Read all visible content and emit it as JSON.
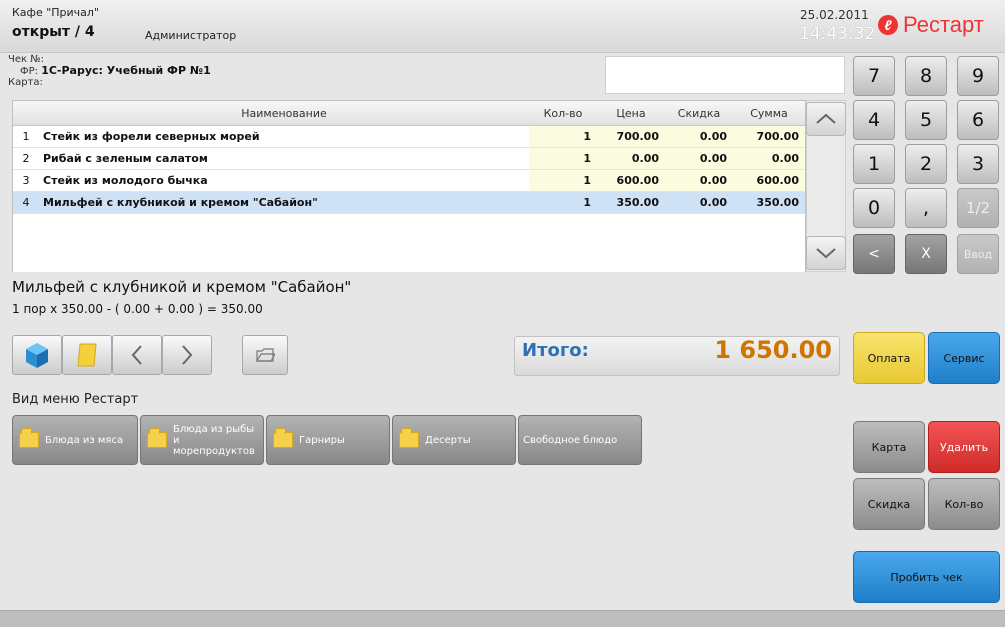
{
  "header": {
    "cafe_name": "Кафе \"Причал\"",
    "status": "открыт / 4",
    "role": "Администратор",
    "date": "25.02.2011",
    "time": "14:43:32",
    "logo": "Рестарт"
  },
  "receipt": {
    "check_label": "Чек №:",
    "fr_label": "ФР:",
    "fr_value": "1С-Рарус: Учебный ФР №1",
    "card_label": "Карта:"
  },
  "table": {
    "columns": [
      "Наименование",
      "Кол-во",
      "Цена",
      "Скидка",
      "Сумма"
    ],
    "rows": [
      {
        "num": "1",
        "name": "Стейк из форели северных морей",
        "qty": "1",
        "price": "700.00",
        "discount": "0.00",
        "sum": "700.00"
      },
      {
        "num": "2",
        "name": "Рибай с зеленым салатом",
        "qty": "1",
        "price": "0.00",
        "discount": "0.00",
        "sum": "0.00"
      },
      {
        "num": "3",
        "name": "Стейк из молодого бычка",
        "qty": "1",
        "price": "600.00",
        "discount": "0.00",
        "sum": "600.00"
      },
      {
        "num": "4",
        "name": "Мильфей с клубникой и кремом \"Сабайон\"",
        "qty": "1",
        "price": "350.00",
        "discount": "0.00",
        "sum": "350.00"
      }
    ]
  },
  "detail": {
    "title": "Мильфей с клубникой и кремом \"Сабайон\"",
    "calc": "1 пор x 350.00 - ( 0.00 + 0.00 ) = 350.00"
  },
  "total": {
    "label": "Итого:",
    "value": "1 650.00"
  },
  "menu": {
    "title": "Вид меню Рестарт",
    "items": [
      {
        "label": "Блюда из мяса"
      },
      {
        "label": "Блюда из рыбы и морепродуктов"
      },
      {
        "label": "Гарниры"
      },
      {
        "label": "Десерты"
      },
      {
        "label": "Свободное блюдо"
      }
    ]
  },
  "keypad": {
    "k7": "7",
    "k8": "8",
    "k9": "9",
    "k4": "4",
    "k5": "5",
    "k6": "6",
    "k1": "1",
    "k2": "2",
    "k3": "3",
    "k0": "0",
    "comma": ",",
    "half": "1/2",
    "back": "<",
    "clear": "X",
    "enter": "Ввод"
  },
  "actions": {
    "pay": "Оплата",
    "service": "Сервис",
    "card": "Карта",
    "delete": "Удалить",
    "discount": "Скидка",
    "quantity": "Кол-во",
    "print": "Пробить чек"
  },
  "colors": {
    "pay": "#f2d64a",
    "service": "#2a8fd8",
    "delete": "#e23b3b",
    "print": "#2a8fd8",
    "total_value": "#d07400",
    "logo": "#e33333"
  }
}
